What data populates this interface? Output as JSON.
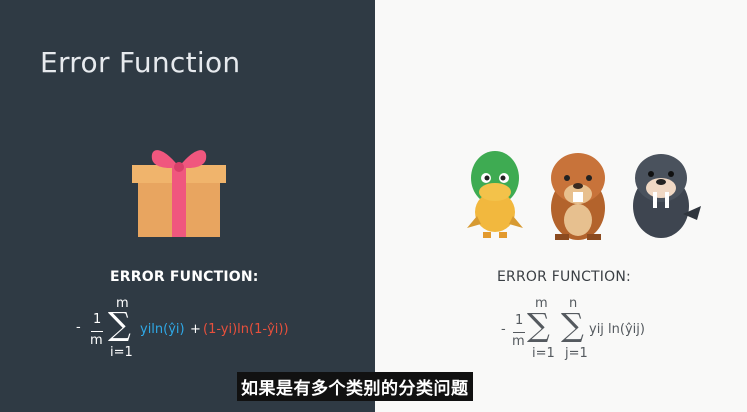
{
  "slide": {
    "title": "Error Function",
    "left_label": "ERROR FUNCTION:",
    "right_label": "ERROR FUNCTION:",
    "left_formula": {
      "minus": "-",
      "frac_num": "1",
      "frac_den": "m",
      "sum_upper": "m",
      "sum_lower": "i=1",
      "term1": "yiln(ŷi)",
      "plus": "+",
      "term2": "(1-yi)ln(1-ŷi))"
    },
    "right_formula": {
      "minus": "-",
      "frac_num": "1",
      "frac_den": "m",
      "sum1_upper": "m",
      "sum1_lower": "i=1",
      "sum2_upper": "n",
      "sum2_lower": "j=1",
      "term": "yij ln(ŷij)"
    }
  },
  "subtitle": "如果是有多个类别的分类问题",
  "colors": {
    "left_bg": "#2f3a44",
    "right_bg": "#f9f9f8",
    "blue_term": "#2fa8e6",
    "red_term": "#e8503c"
  },
  "icons": [
    "gift-icon",
    "duck-icon",
    "beaver-icon",
    "walrus-icon"
  ]
}
